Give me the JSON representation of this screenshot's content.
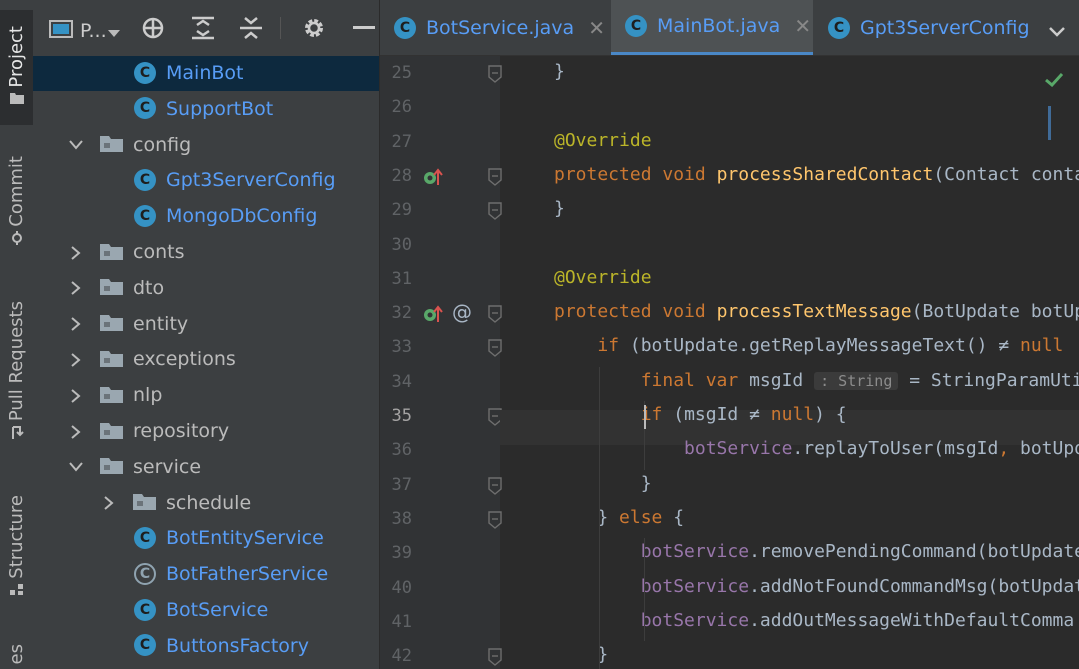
{
  "toolstrip": {
    "tabs": [
      "Project",
      "Commit",
      "Pull Requests",
      "Structure",
      "es"
    ]
  },
  "project_panel": {
    "title": "P...",
    "tree": [
      {
        "label": "MainBot",
        "kind": "class",
        "selected": true
      },
      {
        "label": "SupportBot",
        "kind": "class"
      },
      {
        "label": "config",
        "kind": "folder",
        "expanded": true
      },
      {
        "label": "Gpt3ServerConfig",
        "kind": "class"
      },
      {
        "label": "MongoDbConfig",
        "kind": "class"
      },
      {
        "label": "conts",
        "kind": "folder"
      },
      {
        "label": "dto",
        "kind": "folder"
      },
      {
        "label": "entity",
        "kind": "folder"
      },
      {
        "label": "exceptions",
        "kind": "folder"
      },
      {
        "label": "nlp",
        "kind": "folder"
      },
      {
        "label": "repository",
        "kind": "folder"
      },
      {
        "label": "service",
        "kind": "folder",
        "expanded": true
      },
      {
        "label": "schedule",
        "kind": "folder"
      },
      {
        "label": "BotEntityService",
        "kind": "class"
      },
      {
        "label": "BotFatherService",
        "kind": "abstract-class"
      },
      {
        "label": "BotService",
        "kind": "class"
      },
      {
        "label": "ButtonsFactory",
        "kind": "class"
      }
    ]
  },
  "editor_tabs": [
    {
      "label": "BotService.java",
      "active": false
    },
    {
      "label": "MainBot.java",
      "active": true
    },
    {
      "label": "Gpt3ServerConfig",
      "active": false
    }
  ],
  "editor": {
    "line_numbers": [
      "25",
      "26",
      "27",
      "28",
      "29",
      "30",
      "31",
      "32",
      "33",
      "34",
      "35",
      "36",
      "37",
      "38",
      "39",
      "40",
      "41",
      "42"
    ],
    "current_line": "35",
    "inlay_hint": ": String"
  },
  "colors": {
    "keyword": "#cc7832",
    "annotation": "#bbb529",
    "method": "#ffc66d",
    "field": "#9876aa",
    "text": "#a9b7c6",
    "class_link": "#589df6",
    "selection": "#0d293e"
  }
}
